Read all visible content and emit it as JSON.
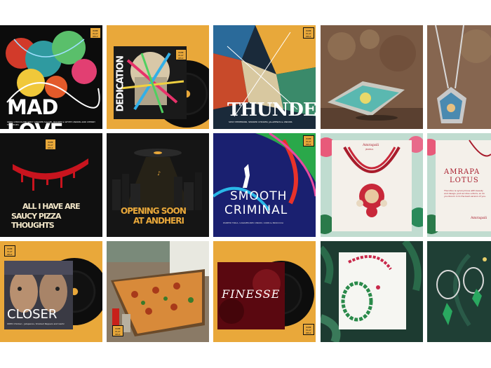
{
  "grid": {
    "tiles": [
      {
        "id": "mad-love",
        "title": "MAD LOVE",
        "subtitle": "OREO CHOCOLATE SPICY CHICKEN SALAMI, ROCKET & WHITE ONIONS AND CHERRY TOMATOES"
      },
      {
        "id": "dedication",
        "title": "DEDICATION"
      },
      {
        "id": "thunder",
        "title": "THUNDER",
        "subtitle": "SPICY PEPPERONI, SMOKED CHICKEN, JALAPENOS & ONIONS"
      },
      {
        "id": "jewel-box"
      },
      {
        "id": "pendant-necklace"
      },
      {
        "id": "saucy-pizza",
        "line1": "ALL I HAVE ARE",
        "line2": "SAUCY PIZZA THOUGHTS"
      },
      {
        "id": "opening-soon",
        "line1": "OPENING SOON",
        "line2": "AT ANDHERI"
      },
      {
        "id": "smooth-criminal",
        "line1": "SMOOTH",
        "line2": "CRIMINAL",
        "subtitle": "PANEER TIKKA, CARAMELISED ONION, CORN & BROCCOLI"
      },
      {
        "id": "amrapali-necklace",
        "brand": "Amrapali",
        "sub": "JEWELS"
      },
      {
        "id": "amrapali-lotus",
        "line1": "AMRAPA",
        "line2": "LOTUS",
        "body": "The lotus is synonymous with beauty and design. Just as lotus unfurls, so do you bloom in to the best version of you.",
        "brand": "Amrapali"
      },
      {
        "id": "closer",
        "title": "CLOSER",
        "subtitle": "OREO Chicken · Jalapenos, Smoked Peppers and Garlic"
      },
      {
        "id": "pizza-slice"
      },
      {
        "id": "finesse",
        "title": "FINESSE"
      },
      {
        "id": "emerald-bracelet"
      },
      {
        "id": "emerald-earrings"
      }
    ]
  },
  "badge_text": "HOME PLAY DELI",
  "colors": {
    "mustard": "#e9a83a",
    "dark": "#111111",
    "forest": "#1f3f35",
    "jewel_red": "#b5223b"
  }
}
